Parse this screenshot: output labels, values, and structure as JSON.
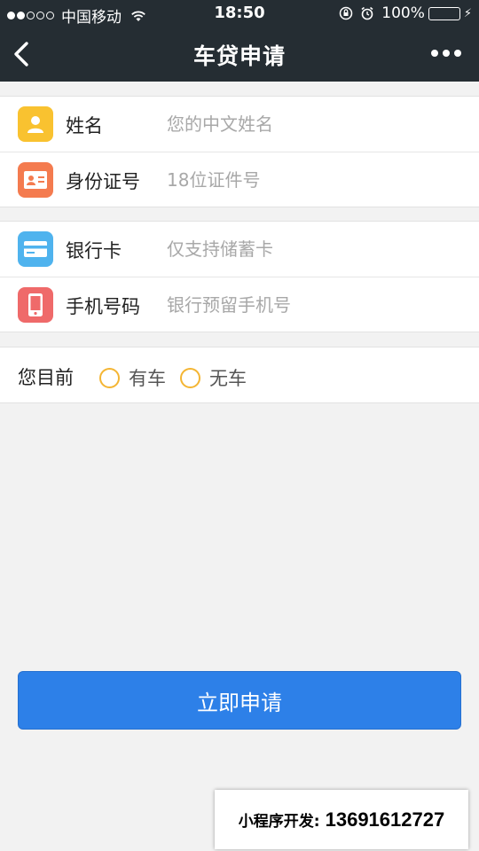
{
  "status_bar": {
    "carrier": "中国移动",
    "time": "18:50",
    "battery": "100%",
    "signal_full": 2,
    "signal_empty": 3,
    "battery_level": 1.0
  },
  "nav": {
    "title": "车贷申请",
    "back_icon": "chevron-left-icon",
    "more_icon": "more-dots-icon"
  },
  "form": {
    "name": {
      "label": "姓名",
      "placeholder": "您的中文姓名",
      "value": "",
      "icon": "user-icon",
      "icon_color": "#f9c230"
    },
    "id_number": {
      "label": "身份证号",
      "placeholder": "18位证件号",
      "value": "",
      "icon": "id-card-icon",
      "icon_color": "#f47b4f"
    },
    "bank_card": {
      "label": "银行卡",
      "placeholder": "仅支持储蓄卡",
      "value": "",
      "icon": "credit-card-icon",
      "icon_color": "#4fb3ee"
    },
    "phone": {
      "label": "手机号码",
      "placeholder": "银行预留手机号",
      "value": "",
      "icon": "phone-icon",
      "icon_color": "#ef6a6a"
    },
    "car_status": {
      "label": "您目前",
      "options": [
        "有车",
        "无车"
      ],
      "selected": null
    }
  },
  "submit_label": "立即申请",
  "contact": {
    "label": "小程序开发:",
    "value": "13691612727"
  },
  "colors": {
    "header_bg": "#252d33",
    "primary": "#2d80e8",
    "radio": "#f4b533",
    "page_bg": "#f2f2f2"
  }
}
